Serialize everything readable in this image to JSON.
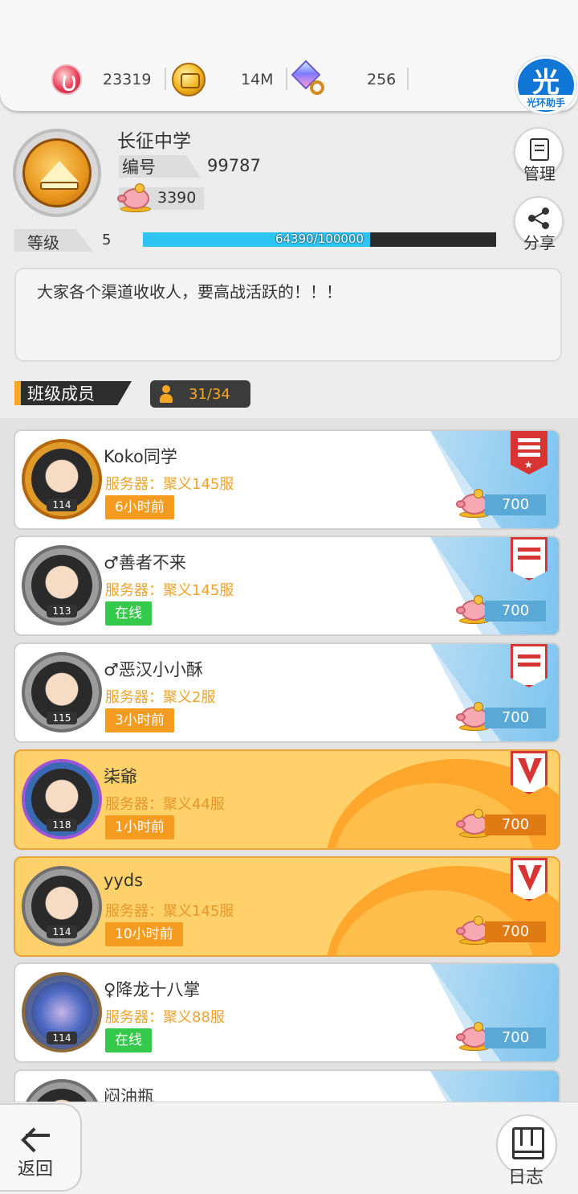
{
  "resources": [
    {
      "icon": "red-coin-icon",
      "value": "23319"
    },
    {
      "icon": "gold-coin-icon",
      "value": "14M"
    },
    {
      "icon": "gem-icon",
      "value": "256"
    }
  ],
  "helper_badge": {
    "big": "光",
    "small": "光环助手"
  },
  "class_info": {
    "name": "长征中学",
    "id_label": "编号",
    "id_value": "99787",
    "pig_value": "3390",
    "level_label": "等级",
    "level_value": "5",
    "exp_text": "64390/100000",
    "exp_fraction": 0.6439,
    "notice": "大家各个渠道收收人，要高战活跃的！！！"
  },
  "side_buttons": {
    "manage": "管理",
    "share": "分享"
  },
  "members_header": {
    "title": "班级成员",
    "count": "31/34"
  },
  "members": [
    {
      "name": "Koko同学",
      "server": "服务器：聚义145服",
      "status": "6小时前",
      "online": false,
      "level": "114",
      "contrib": "700",
      "style": "white",
      "rank": "leader",
      "avatar": "dragon"
    },
    {
      "name": "♂善者不来",
      "server": "服务器：聚义145服",
      "status": "在线",
      "online": true,
      "level": "113",
      "contrib": "700",
      "style": "white",
      "rank": "member",
      "avatar": "normal"
    },
    {
      "name": "♂恶汉小小酥",
      "server": "服务器：聚义2服",
      "status": "3小时前",
      "online": false,
      "level": "115",
      "contrib": "700",
      "style": "white",
      "rank": "member",
      "avatar": "normal"
    },
    {
      "name": "柒爺",
      "server": "服务器：聚义44服",
      "status": "1小时前",
      "online": false,
      "level": "118",
      "contrib": "700",
      "style": "gold",
      "rank": "v",
      "avatar": "cat"
    },
    {
      "name": "yyds",
      "server": "服务器：聚义145服",
      "status": "10小时前",
      "online": false,
      "level": "114",
      "contrib": "700",
      "style": "gold",
      "rank": "v",
      "avatar": "normal"
    },
    {
      "name": "♀降龙十八掌",
      "server": "服务器：聚义88服",
      "status": "在线",
      "online": true,
      "level": "114",
      "contrib": "700",
      "style": "white",
      "rank": "none",
      "avatar": "luck"
    },
    {
      "name": "闷油瓶",
      "server": "",
      "status": "",
      "online": false,
      "level": "",
      "contrib": "",
      "style": "white",
      "rank": "none",
      "avatar": "normal"
    }
  ],
  "bottom": {
    "back": "返回",
    "log": "日志"
  }
}
